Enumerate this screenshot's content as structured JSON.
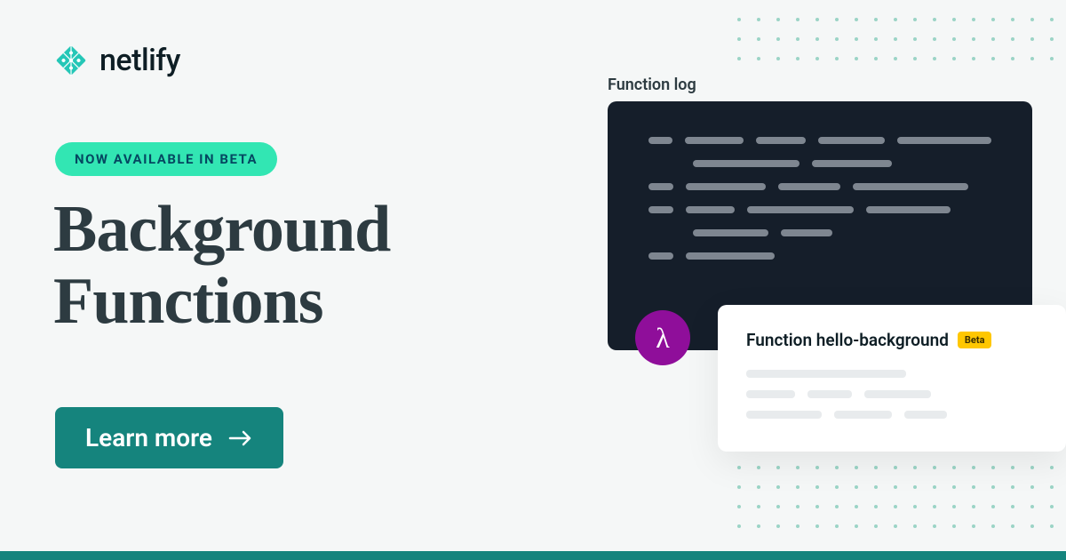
{
  "brand": "netlify",
  "badge": "NOW AVAILABLE IN BETA",
  "headline_line1": "Background",
  "headline_line2": "Functions",
  "cta": "Learn more",
  "panel_label": "Function log",
  "card_title": "Function hello-background",
  "beta_tag": "Beta",
  "lambda": "λ",
  "colors": {
    "accent": "#32e6b3",
    "primary": "#15847d",
    "dark": "#151e2a",
    "lambda_bg": "#8f0e9a",
    "beta_bg": "#ffc700"
  }
}
